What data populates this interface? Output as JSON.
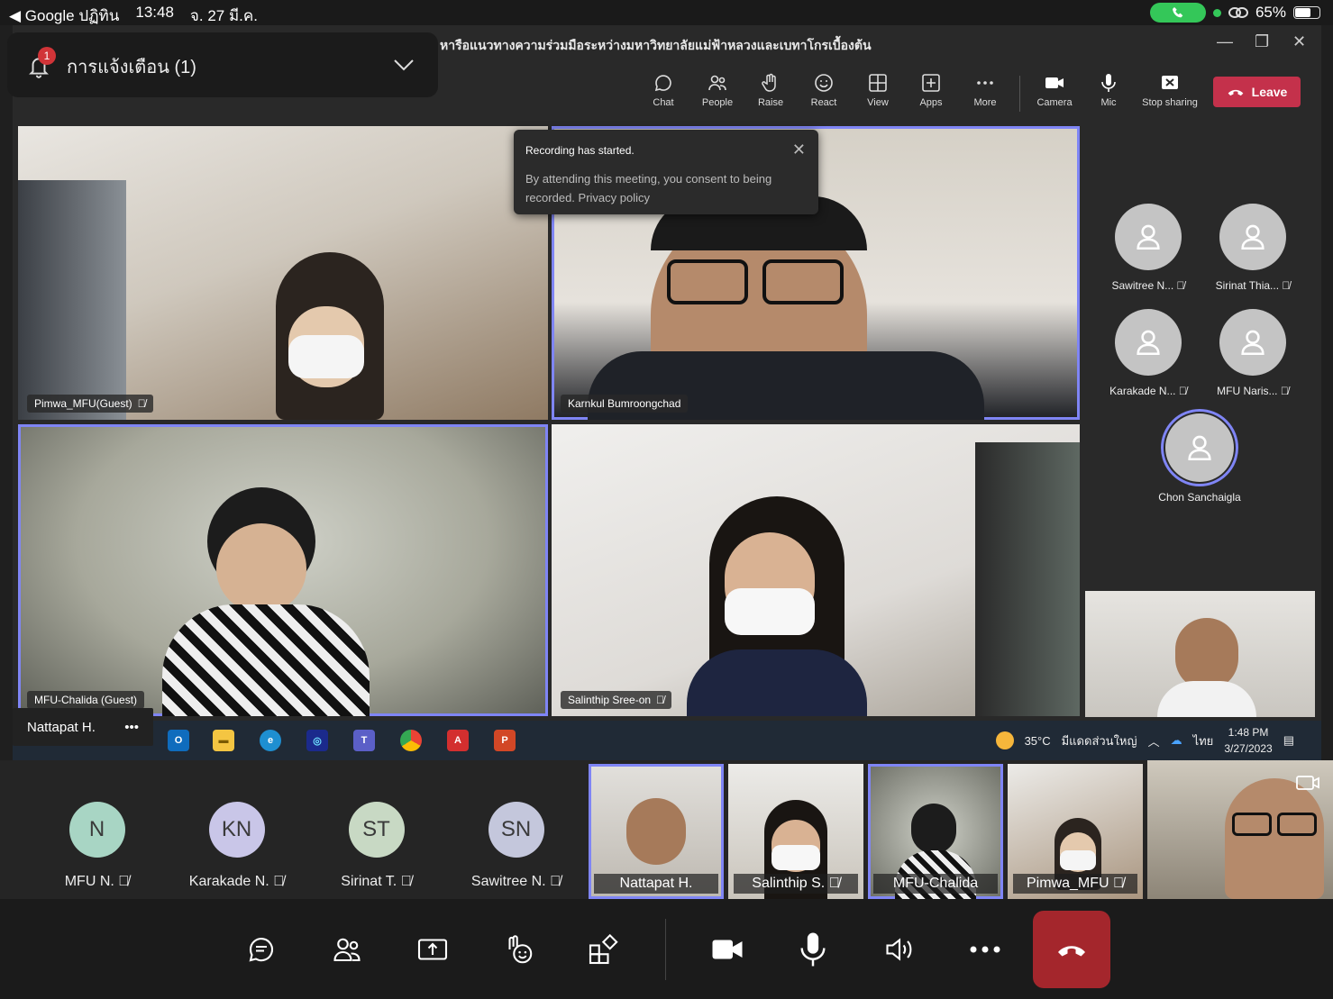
{
  "status_bar": {
    "back_label": "◀ Google ปฏิทิน",
    "time": "13:48",
    "date": "จ. 27 มี.ค.",
    "battery": "65%"
  },
  "notification": {
    "badge": "1",
    "text": "การแจ้งเตือน (1)"
  },
  "window": {
    "title": "หารือแนวทางความร่วมมือระหว่างมหาวิทยาลัยแม่ฟ้าหลวงและเบทาโกรเบื้องต้น"
  },
  "toolbar": {
    "chat": "Chat",
    "people": "People",
    "raise": "Raise",
    "react": "React",
    "view": "View",
    "apps": "Apps",
    "more": "More",
    "camera": "Camera",
    "mic": "Mic",
    "stop_sharing": "Stop sharing",
    "leave": "Leave"
  },
  "toast": {
    "title": "Recording has started.",
    "body": "By attending this meeting, you consent to being recorded. Privacy policy"
  },
  "tiles": {
    "pimwa": "Pimwa_MFU(Guest)",
    "karnkul": "Karnkul Bumroongchad",
    "chalida": "MFU-Chalida (Guest)",
    "salinthip": "Salinthip Sree-on"
  },
  "side_participants": {
    "sawitree": "Sawitree N...",
    "sirinat": "Sirinat Thia...",
    "karakade": "Karakade N...",
    "mfu_naris": "MFU Naris...",
    "chon": "Chon Sanchaigla"
  },
  "nattapat_chip": "Nattapat H.",
  "taskbar": {
    "temperature": "35°C",
    "weather": "มีแดดส่วนใหญ่",
    "lang": "ไทย",
    "time": "1:48 PM",
    "date": "3/27/2023"
  },
  "strip": [
    {
      "initials": "N",
      "name": "MFU N."
    },
    {
      "initials": "KN",
      "name": "Karakade N."
    },
    {
      "initials": "ST",
      "name": "Sirinat T."
    },
    {
      "initials": "SN",
      "name": "Sawitree N."
    },
    {
      "name": "Nattapat H."
    },
    {
      "name": "Salinthip S."
    },
    {
      "name": "MFU-Chalida"
    },
    {
      "name": "Pimwa_MFU"
    }
  ],
  "colors": {
    "accent": "#7f85f5",
    "leave": "#c4314b",
    "end_call": "#a4262c",
    "avatar_n": "#a8d5c4",
    "avatar_kn": "#c9c6e8",
    "avatar_st": "#c8d9c4",
    "avatar_sn": "#c4c7dc"
  }
}
